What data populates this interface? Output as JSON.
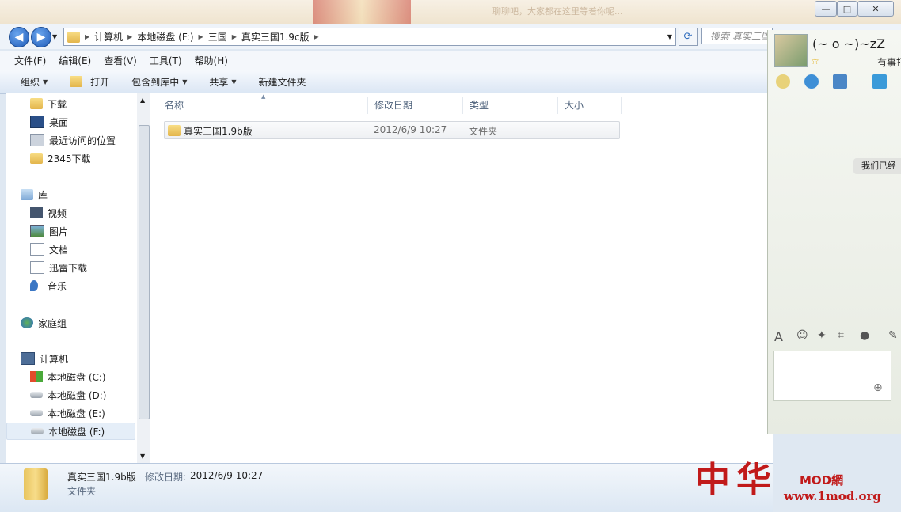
{
  "titlebar": {
    "ghost_text": "聊聊吧，大家都在这里等着你呢..."
  },
  "window_buttons": {
    "minimize": "—",
    "maximize": "□",
    "close": "✕"
  },
  "nav": {
    "back": "◀",
    "forward": "▶"
  },
  "address": {
    "crumbs": [
      "计算机",
      "本地磁盘 (F:)",
      "三国",
      "真实三国1.9c版"
    ],
    "search_placeholder": "搜索 真实三国"
  },
  "menu": [
    "文件(F)",
    "编辑(E)",
    "查看(V)",
    "工具(T)",
    "帮助(H)"
  ],
  "toolbar": {
    "organize": "组织",
    "open": "打开",
    "include": "包含到库中",
    "share": "共享",
    "new_folder": "新建文件夹"
  },
  "navpane": {
    "favorites": [
      "下载",
      "桌面",
      "最近访问的位置",
      "2345下载"
    ],
    "library": "库",
    "library_items": [
      "视频",
      "图片",
      "文档",
      "迅雷下载",
      "音乐"
    ],
    "homegroup": "家庭组",
    "computer": "计算机",
    "drives": [
      "本地磁盘 (C:)",
      "本地磁盘 (D:)",
      "本地磁盘 (E:)",
      "本地磁盘 (F:)"
    ]
  },
  "columns": {
    "name": "名称",
    "modified": "修改日期",
    "type": "类型",
    "size": "大小"
  },
  "files": [
    {
      "name": "真实三国1.9b版",
      "modified": "2012/6/9 10:27",
      "type": "文件夹"
    }
  ],
  "details": {
    "name": "真实三国1.9b版",
    "modified_label": "修改日期:",
    "modified": "2012/6/9 10:27",
    "type": "文件夹"
  },
  "qq": {
    "nickname": "(~ o ~)~zZ",
    "status": "有事打",
    "bubble": "我们已经",
    "star": "☆"
  },
  "watermark": {
    "chars": "中华",
    "mod": "MOD網",
    "url": "www.1mod.org"
  }
}
